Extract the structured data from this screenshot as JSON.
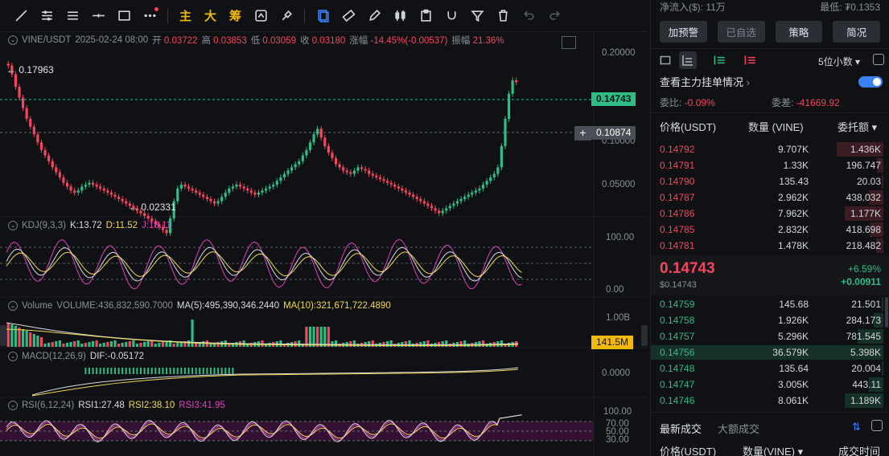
{
  "toolbar": {
    "labels": {
      "main": "主",
      "big": "大",
      "chips": "筹"
    }
  },
  "chart": {
    "symbol": "VINE/USDT",
    "date": "2025-02-24 08:00",
    "open_label": "开",
    "open": "0.03722",
    "high_label": "高",
    "high": "0.03853",
    "low_label": "低",
    "low": "0.03059",
    "close_label": "收",
    "close": "0.03180",
    "change_label": "涨幅",
    "change": "-14.45%(-0.00537)",
    "amp_label": "振幅",
    "amp": "21.36%",
    "price_axis": [
      "0.20000",
      "0.10000",
      "0.05000"
    ],
    "high_marker": "← 0.17963",
    "low_marker": "← 0.02331",
    "current_price_tag": "0.14743",
    "crosshair_tag": "0.10874",
    "kdj": {
      "name": "KDJ(9,3,3)",
      "k": "K:13.72",
      "d": "D:11.52",
      "j": "J:18.11",
      "axis": [
        "100.00",
        "0.00"
      ]
    },
    "volume": {
      "name": "Volume",
      "vol": "VOLUME:436,832,590.7000",
      "ma5": "MA(5):495,390,346.2440",
      "ma10": "MA(10):321,671,722.4890",
      "axis": [
        "1.00B"
      ],
      "tag": "141.5M"
    },
    "macd": {
      "name": "MACD(12,26,9)",
      "dif": "DIF:-0.05172",
      "axis": [
        "0.0000"
      ]
    },
    "rsi": {
      "name": "RSI(6,12,24)",
      "r1": "RSI1:27.48",
      "r2": "RSI2:38.10",
      "r3": "RSI3:41.95",
      "axis": [
        "100.00",
        "70.00",
        "50.00",
        "30.00"
      ]
    },
    "kline_closes": [
      0.175,
      0.16,
      0.14,
      0.125,
      0.112,
      0.1,
      0.092,
      0.085,
      0.078,
      0.072,
      0.068,
      0.064,
      0.06,
      0.057,
      0.054,
      0.051,
      0.049,
      0.047,
      0.046,
      0.047,
      0.049,
      0.05,
      0.051,
      0.05,
      0.049,
      0.048,
      0.047,
      0.046,
      0.045,
      0.044,
      0.043,
      0.042,
      0.041,
      0.04,
      0.039,
      0.038,
      0.037,
      0.036,
      0.035,
      0.034,
      0.033,
      0.032,
      0.031,
      0.03,
      0.035,
      0.042,
      0.048,
      0.05,
      0.049,
      0.048,
      0.047,
      0.046,
      0.045,
      0.044,
      0.043,
      0.042,
      0.041,
      0.042,
      0.044,
      0.046,
      0.048,
      0.049,
      0.05,
      0.049,
      0.048,
      0.047,
      0.046,
      0.045,
      0.046,
      0.047,
      0.048,
      0.049,
      0.05,
      0.052,
      0.054,
      0.056,
      0.058,
      0.06,
      0.062,
      0.064,
      0.068,
      0.072,
      0.078,
      0.085,
      0.09,
      0.082,
      0.075,
      0.07,
      0.066,
      0.062,
      0.06,
      0.058,
      0.057,
      0.056,
      0.058,
      0.06,
      0.059,
      0.058,
      0.056,
      0.055,
      0.054,
      0.053,
      0.052,
      0.051,
      0.05,
      0.049,
      0.048,
      0.047,
      0.046,
      0.045,
      0.044,
      0.043,
      0.042,
      0.041,
      0.04,
      0.039,
      0.038,
      0.037,
      0.038,
      0.039,
      0.04,
      0.041,
      0.042,
      0.043,
      0.044,
      0.045,
      0.046,
      0.047,
      0.048,
      0.05,
      0.052,
      0.054,
      0.056,
      0.06,
      0.075,
      0.1,
      0.13,
      0.15,
      0.147
    ]
  },
  "panel": {
    "top_left": "净流入($): 11万",
    "top_right": "最低: ₮0.1353",
    "buttons": [
      "加预警",
      "已自选",
      "策略",
      "简况"
    ],
    "decimals": "5位小数",
    "orders_title": "查看主力挂单情况",
    "ratio_label": "委比:",
    "ratio": "-0.09%",
    "diff_label": "委差:",
    "diff": "-41669.92",
    "cols": [
      "价格(USDT)",
      "数量 (VINE)",
      "委托额"
    ],
    "asks": [
      [
        "0.14792",
        "9.707K",
        "1.436K"
      ],
      [
        "0.14791",
        "1.33K",
        "196.747"
      ],
      [
        "0.14790",
        "135.43",
        "20.03"
      ],
      [
        "0.14787",
        "2.962K",
        "438.032"
      ],
      [
        "0.14786",
        "7.962K",
        "1.177K"
      ],
      [
        "0.14785",
        "2.832K",
        "418.698"
      ],
      [
        "0.14781",
        "1.478K",
        "218.482"
      ]
    ],
    "last_price": "0.14743",
    "last_usd": "$0.14743",
    "pct_change": "+6.59%",
    "abs_change": "+0.00911",
    "bids": [
      [
        "0.14759",
        "145.68",
        "21.501"
      ],
      [
        "0.14758",
        "1.926K",
        "284.173"
      ],
      [
        "0.14757",
        "5.296K",
        "781.545"
      ],
      [
        "0.14756",
        "36.579K",
        "5.398K"
      ],
      [
        "0.14748",
        "135.64",
        "20.004"
      ],
      [
        "0.14747",
        "3.005K",
        "443.11"
      ],
      [
        "0.14746",
        "8.061K",
        "1.189K"
      ]
    ],
    "trades_tabs": [
      "最新成交",
      "大额成交"
    ],
    "trade_cols": [
      "价格(USDT)",
      "数量(VINE)",
      "成交时间"
    ]
  },
  "colors": {
    "up": "#2ebd85",
    "down": "#f6465d",
    "accent": "#3b82f6",
    "yellow": "#f0b90b"
  }
}
